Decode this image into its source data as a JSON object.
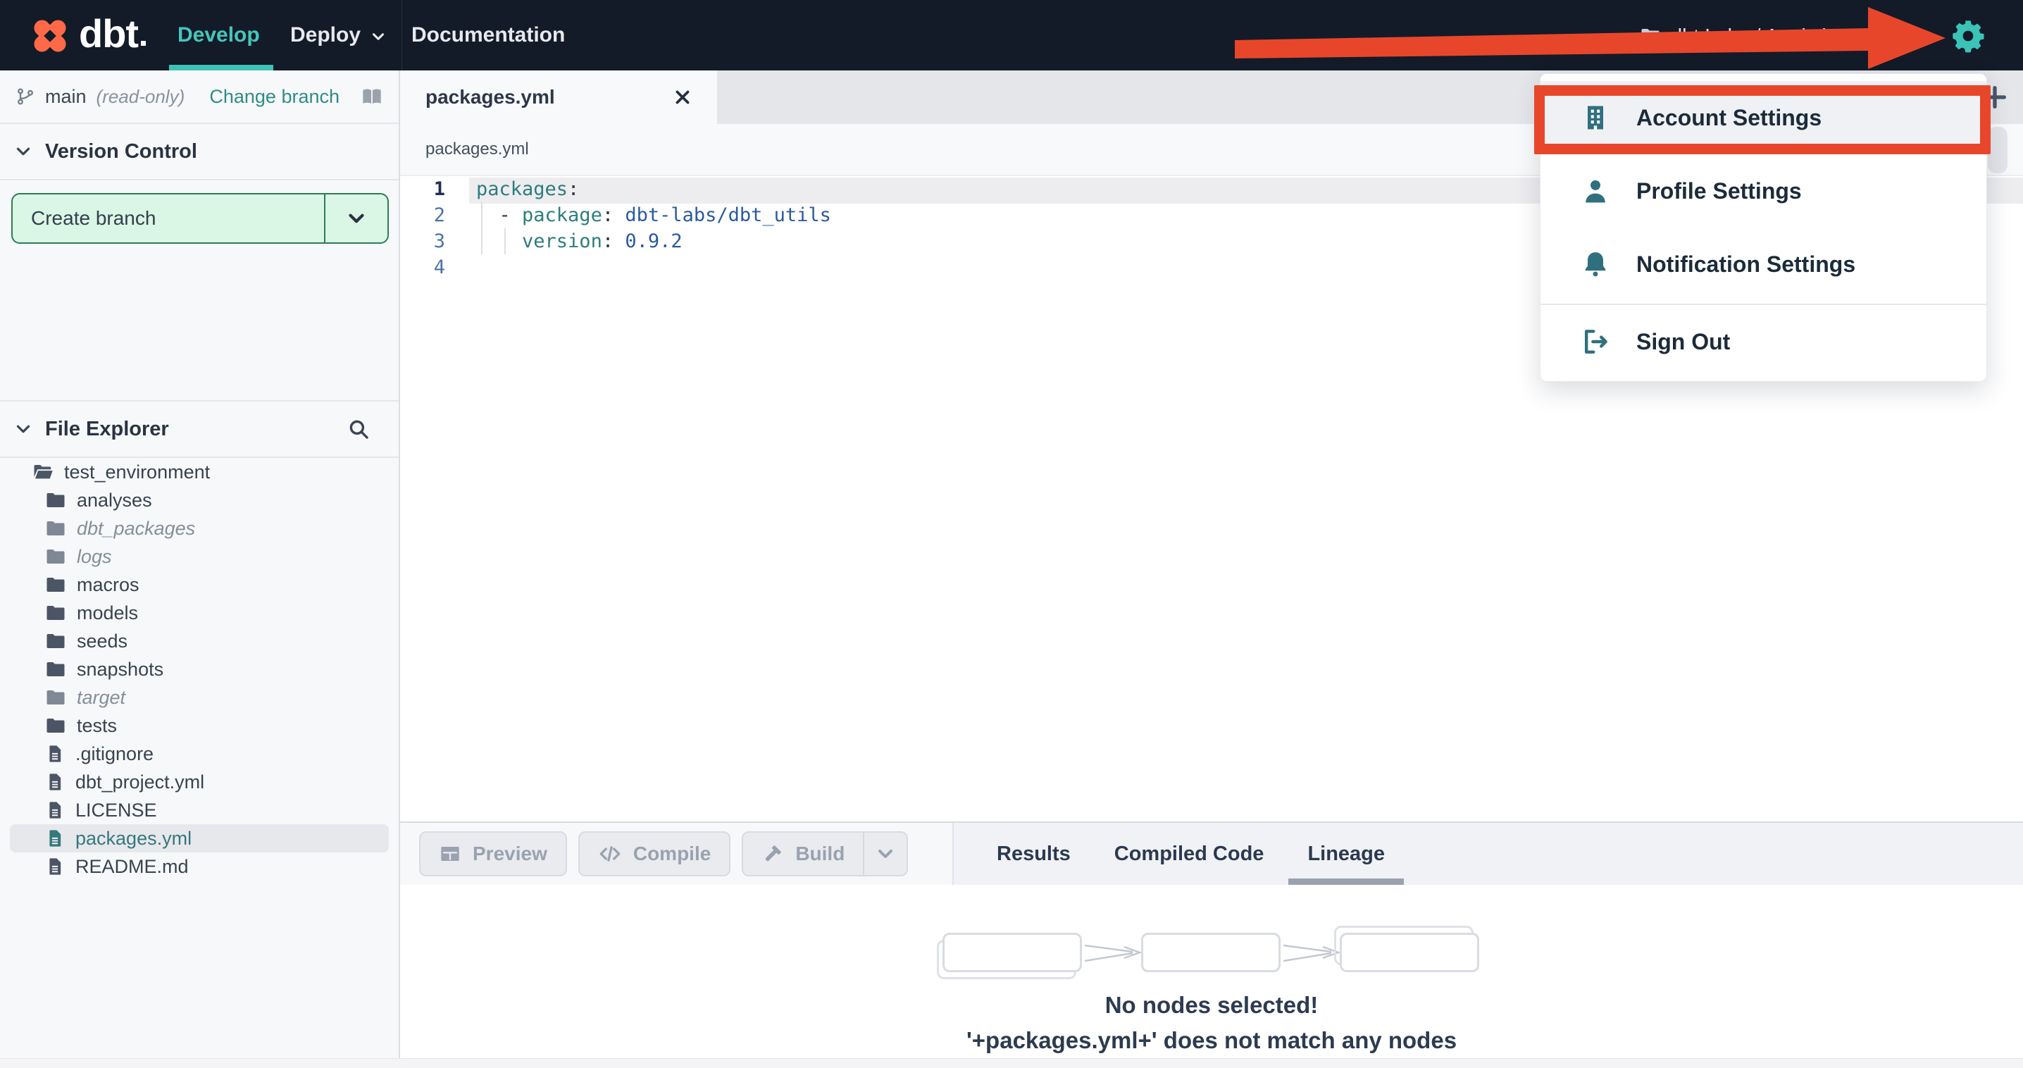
{
  "topbar": {
    "wordmark": "dbt",
    "nav": [
      {
        "label": "Develop",
        "active": true
      },
      {
        "label": "Deploy",
        "has_caret": true
      },
      {
        "label": "Documentation"
      }
    ],
    "account_label": "dbt Labs / Analytics"
  },
  "user_menu": {
    "items": [
      {
        "label": "Account Settings",
        "icon": "building",
        "annotated": true
      },
      {
        "label": "Profile Settings",
        "icon": "person"
      },
      {
        "label": "Notification Settings",
        "icon": "bell"
      },
      {
        "label": "Sign Out",
        "icon": "signout",
        "divider_before": true,
        "short": true
      }
    ]
  },
  "vc": {
    "branch": "main",
    "readonly": "(read-only)",
    "change_branch_label": "Change branch",
    "section_title": "Version Control",
    "create_branch_label": "Create branch"
  },
  "explorer": {
    "title": "File Explorer",
    "tree": [
      {
        "name": "test_environment",
        "kind": "folder-open",
        "level": 0
      },
      {
        "name": "analyses",
        "kind": "folder",
        "level": 1
      },
      {
        "name": "dbt_packages",
        "kind": "folder",
        "level": 1,
        "italic": true
      },
      {
        "name": "logs",
        "kind": "folder",
        "level": 1,
        "italic": true
      },
      {
        "name": "macros",
        "kind": "folder",
        "level": 1
      },
      {
        "name": "models",
        "kind": "folder",
        "level": 1
      },
      {
        "name": "seeds",
        "kind": "folder",
        "level": 1
      },
      {
        "name": "snapshots",
        "kind": "folder",
        "level": 1
      },
      {
        "name": "target",
        "kind": "folder",
        "level": 1,
        "italic": true
      },
      {
        "name": "tests",
        "kind": "folder",
        "level": 1
      },
      {
        "name": ".gitignore",
        "kind": "file",
        "level": 1
      },
      {
        "name": "dbt_project.yml",
        "kind": "file",
        "level": 1
      },
      {
        "name": "LICENSE",
        "kind": "file",
        "level": 1
      },
      {
        "name": "packages.yml",
        "kind": "file",
        "level": 1,
        "selected": true
      },
      {
        "name": "README.md",
        "kind": "file",
        "level": 1
      }
    ]
  },
  "editor": {
    "tab_title": "packages.yml",
    "breadcrumb": "packages.yml",
    "active_line": 1,
    "code": {
      "lines": [
        [
          {
            "c": "key",
            "t": "packages"
          },
          {
            "c": "p",
            "t": ":"
          }
        ],
        [
          {
            "c": "p",
            "t": "  - "
          },
          {
            "c": "key",
            "t": "package"
          },
          {
            "c": "p",
            "t": ": "
          },
          {
            "c": "val",
            "t": "dbt-labs/dbt_utils"
          }
        ],
        [
          {
            "c": "p",
            "t": "    "
          },
          {
            "c": "key",
            "t": "version"
          },
          {
            "c": "p",
            "t": ": "
          },
          {
            "c": "val",
            "t": "0.9.2"
          }
        ],
        []
      ]
    }
  },
  "panel": {
    "buttons": [
      {
        "label": "Preview",
        "icon": "grid",
        "disabled": true
      },
      {
        "label": "Compile",
        "icon": "code",
        "disabled": true
      },
      {
        "label": "Build",
        "icon": "hammer",
        "disabled": true,
        "split": true
      }
    ],
    "tabs": [
      {
        "label": "Results"
      },
      {
        "label": "Compiled Code"
      },
      {
        "label": "Lineage",
        "active": true
      }
    ]
  },
  "lineage": {
    "placeholder_nodes": 3,
    "messages": [
      "No nodes selected!",
      "'+packages.yml+' does not match any nodes"
    ]
  },
  "colors": {
    "topbar_bg": "#131b28",
    "accent_teal": "#3fc3b7",
    "logo_orange": "#ff6947",
    "annotation_red": "#e8462b",
    "create_branch_bg": "#daf6e4",
    "create_branch_border": "#2c7c57",
    "selected_file_teal": "#35787d",
    "code_key": "#2e7d7d",
    "code_value": "#2b5a9e"
  }
}
